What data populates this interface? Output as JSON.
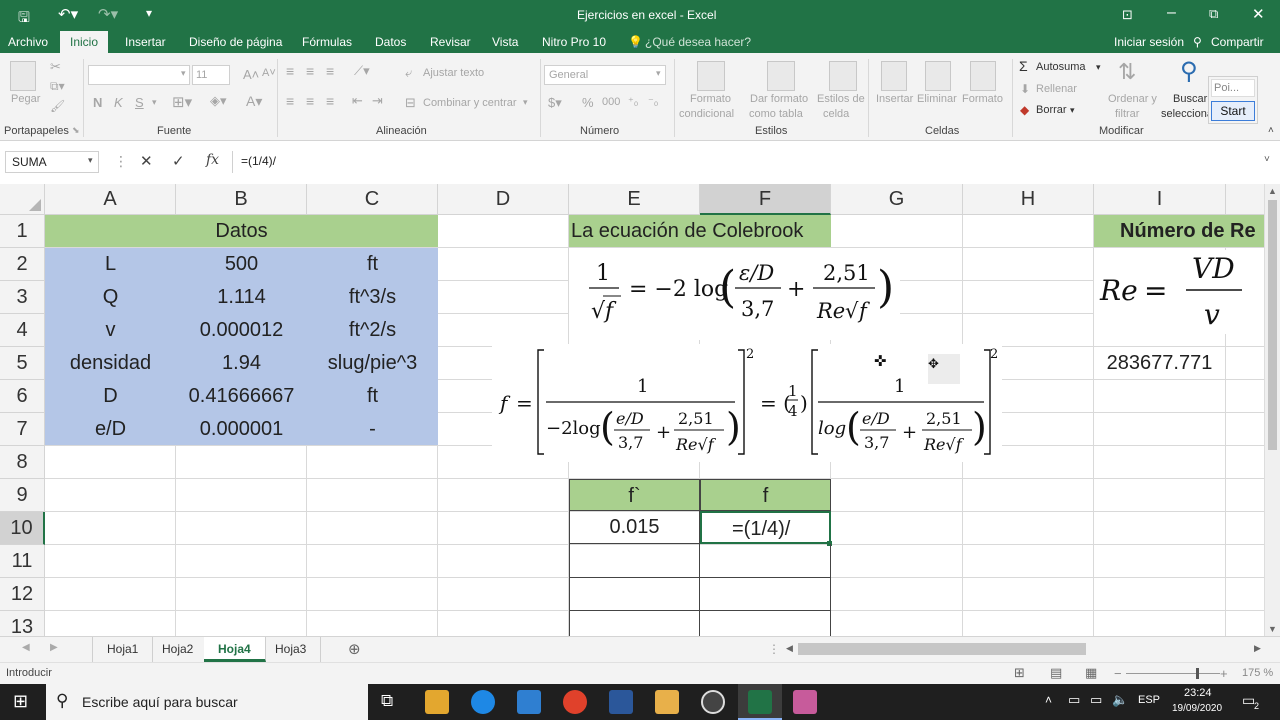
{
  "window": {
    "title": "Ejercicios en excel - Excel"
  },
  "menu": {
    "items": [
      "Archivo",
      "Inicio",
      "Insertar",
      "Diseño de página",
      "Fórmulas",
      "Datos",
      "Revisar",
      "Vista",
      "Nitro Pro 10"
    ],
    "tell_me": "¿Qué desea hacer?",
    "sign_in": "Iniciar sesión",
    "share": "Compartir"
  },
  "ribbon": {
    "paste": "Pegar",
    "font_size": "11",
    "bold": "N",
    "italic": "K",
    "underline": "S",
    "wrap_text": "Ajustar texto",
    "merge_center": "Combinar y centrar",
    "number_format": "General",
    "conditional_format": [
      "Formato",
      "condicional"
    ],
    "format_table": [
      "Dar formato",
      "como tabla"
    ],
    "cell_styles": [
      "Estilos de",
      "celda"
    ],
    "insert": "Insertar",
    "delete": "Eliminar",
    "format": "Formato",
    "autosum": "Autosuma",
    "fill": "Rellenar",
    "clear": "Borrar",
    "sort_filter": [
      "Ordenar y",
      "filtrar"
    ],
    "find_select": [
      "Buscar y",
      "seleccionar"
    ],
    "groups": [
      "Portapapeles",
      "Fuente",
      "Alineación",
      "Número",
      "Estilos",
      "Celdas",
      "Modificar"
    ],
    "popup_input": "Poi...",
    "popup_button": "Start"
  },
  "formula_bar": {
    "name_box": "SUMA",
    "content": "=(1/4)/"
  },
  "columns": [
    "A",
    "B",
    "C",
    "D",
    "E",
    "F",
    "G",
    "H",
    "I"
  ],
  "rows": [
    "1",
    "2",
    "3",
    "4",
    "5",
    "6",
    "7",
    "8",
    "9",
    "10",
    "11",
    "12",
    "13"
  ],
  "cells": {
    "datos_header": "Datos",
    "data_rows": [
      {
        "a": "L",
        "b": "500",
        "c": "ft"
      },
      {
        "a": "Q",
        "b": "1.114",
        "c": "ft^3/s"
      },
      {
        "a": "v",
        "b": "0.000012",
        "c": "ft^2/s"
      },
      {
        "a": "densidad",
        "b": "1.94",
        "c": "slug/pie^3"
      },
      {
        "a": "D",
        "b": "0.41666667",
        "c": "ft"
      },
      {
        "a": "e/D",
        "b": "0.000001",
        "c": "-"
      }
    ],
    "colebrook_title": "La ecuación de Colebrook",
    "reynolds_title": "Número de Re",
    "reynolds_value": "283677.771",
    "e9": "f`",
    "f9": "f",
    "e10": "0.015",
    "f10": "=(1/4)/"
  },
  "sheets": [
    "Hoja1",
    "Hoja2",
    "Hoja4",
    "Hoja3"
  ],
  "active_sheet": "Hoja4",
  "status": {
    "mode": "Introducir",
    "zoom": "175 %"
  },
  "taskbar": {
    "search": "Escribe aquí para buscar",
    "lang": "ESP",
    "time": "23:24",
    "date": "19/09/2020",
    "notif_count": "2"
  },
  "colors": {
    "excel_green": "#217346",
    "header_green": "#a9d08e",
    "data_blue": "#b4c6e7"
  }
}
